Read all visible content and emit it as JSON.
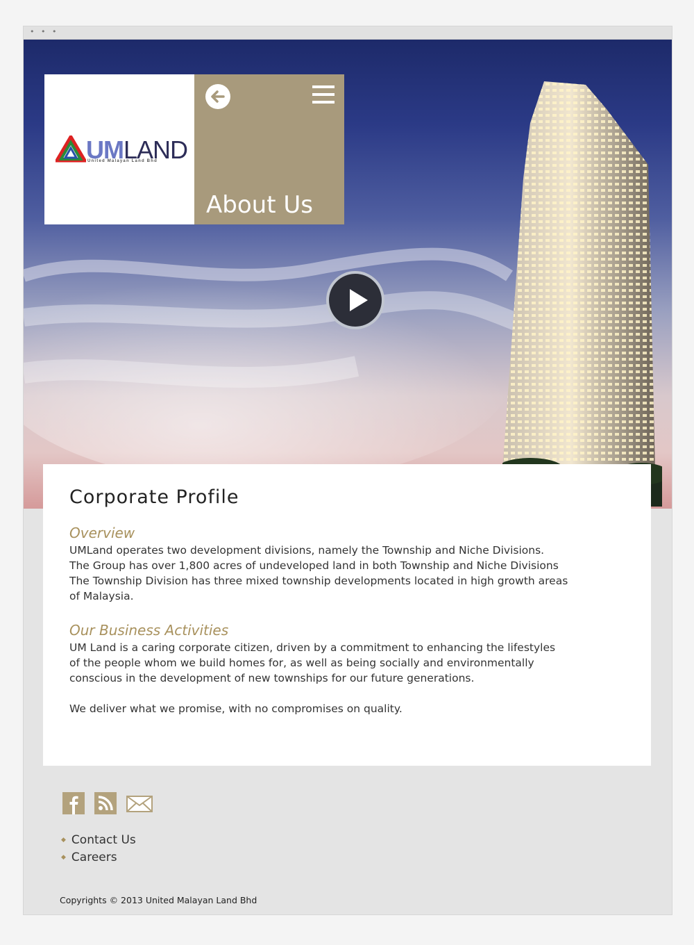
{
  "window": {
    "dots": "• • •"
  },
  "brand": {
    "logo_primary": "UM",
    "logo_secondary": "LAND",
    "logo_tagline": "United Malayan Land Bhd"
  },
  "header": {
    "page_title": "About Us",
    "back_icon": "arrow-left-icon",
    "menu_icon": "hamburger-menu-icon"
  },
  "hero": {
    "play_icon": "play-icon"
  },
  "content": {
    "heading": "Corporate Profile",
    "overview_title": "Overview",
    "overview_lines": [
      "UMLand operates two development divisions, namely the Township and Niche Divisions.",
      "The Group has over 1,800 acres of undeveloped land in both Township and Niche Divisions",
      "The Township Division has three mixed township developments located in high growth areas",
      "of Malaysia."
    ],
    "business_title": "Our Business Activities",
    "business_lines": [
      "UM Land is a caring corporate citizen, driven by a commitment to enhancing the lifestyles",
      "of the people whom we build homes for, as well as being socially and environmentally",
      "conscious in the development of new townships for our future generations."
    ],
    "promise": "We deliver what we promise, with no compromises on quality."
  },
  "footer": {
    "social": [
      "facebook-icon",
      "rss-icon",
      "mail-icon"
    ],
    "links": [
      "Contact Us",
      "Careers"
    ],
    "copyright": "Copyrights © 2013 United Malayan Land Bhd"
  },
  "colors": {
    "accent": "#a89a7c",
    "heading_gold": "#a8915d"
  }
}
